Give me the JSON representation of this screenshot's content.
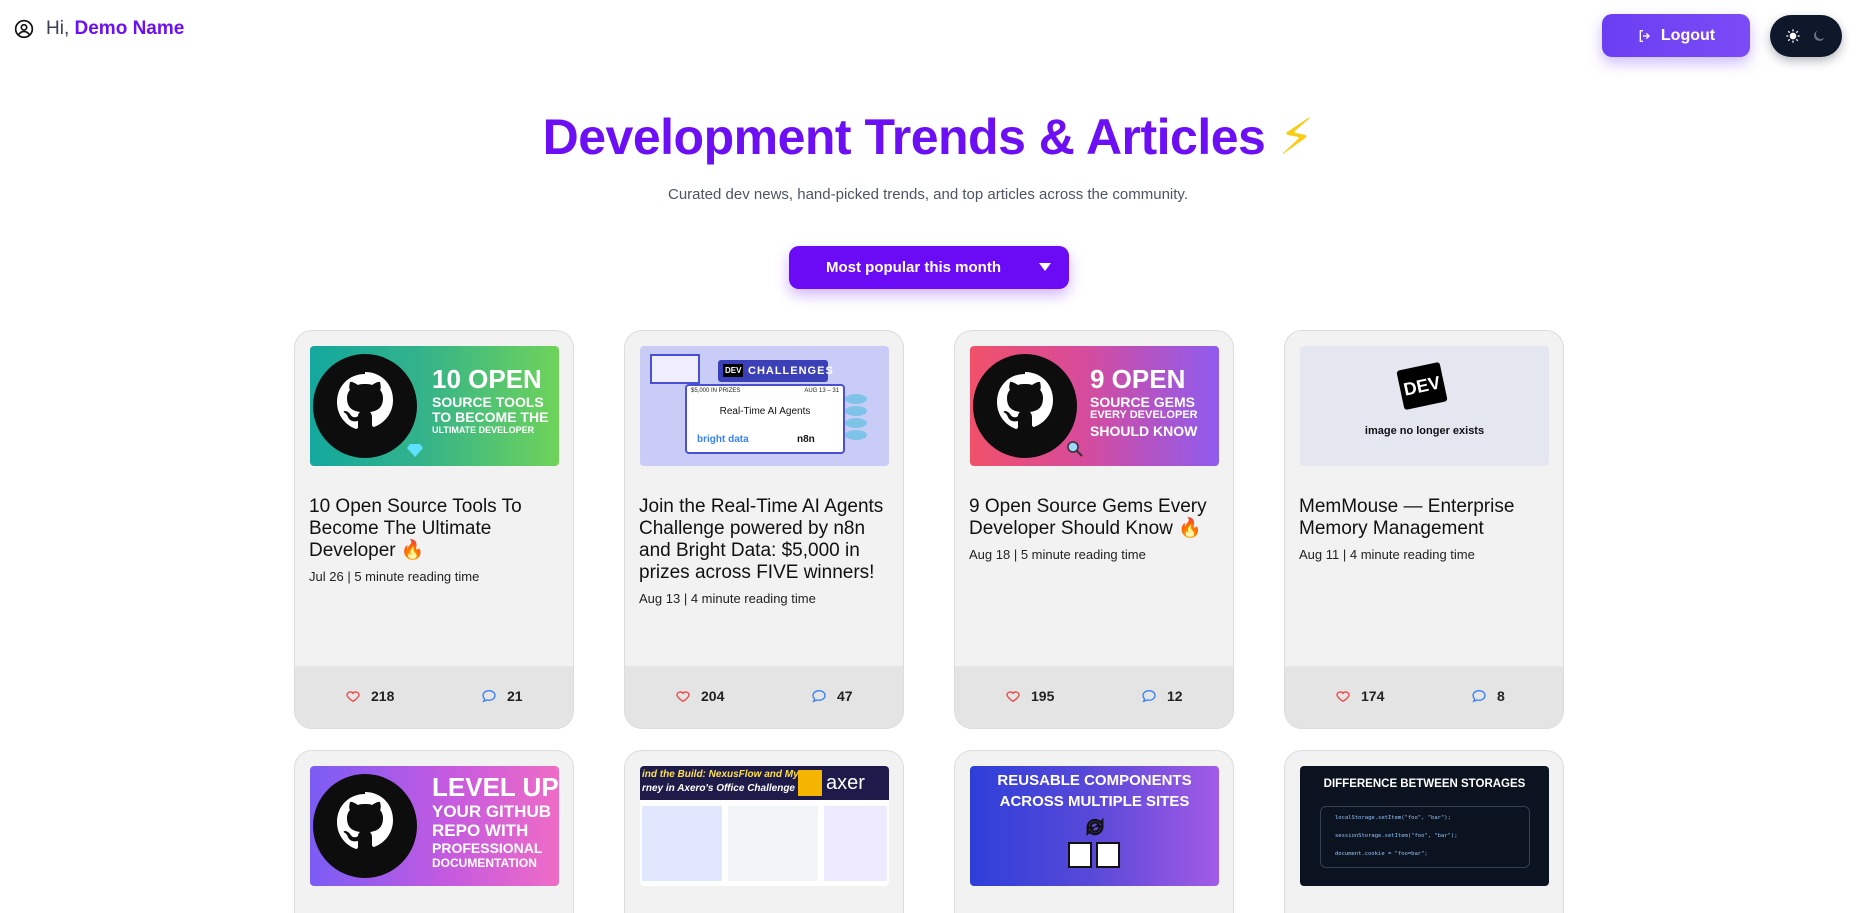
{
  "user": {
    "greeting": "Hi,",
    "name": "Demo Name"
  },
  "header": {
    "logout_label": "Logout"
  },
  "hero": {
    "title": "Development Trends & Articles",
    "emoji": "⚡",
    "subtitle": "Curated dev news, hand-picked trends, and top articles across the community."
  },
  "filter": {
    "selected": "Most popular this month"
  },
  "colors": {
    "accent": "#6d0ff5",
    "button": "#6b0af5",
    "logout": "#6a3ef2",
    "heart": "#ef4444",
    "comment": "#3b82f6"
  },
  "cards": [
    {
      "title": "10 Open Source Tools To Become The Ultimate Developer 🔥",
      "date": "Jul 26",
      "reading": "5 minute reading time",
      "likes": "218",
      "comments": "21",
      "thumb": {
        "line1": "10 OPEN",
        "line2": "SOURCE TOOLS",
        "line3": "TO BECOME THE",
        "line4": "ULTIMATE DEVELOPER"
      }
    },
    {
      "title": "Join the Real-Time AI Agents Challenge powered by n8n and Bright Data: $5,000 in prizes across FIVE winners!",
      "date": "Aug 13",
      "reading": "4 minute reading time",
      "likes": "204",
      "comments": "47",
      "thumb": {
        "badge": "DEV",
        "tag": "CHALLENGES",
        "prize": "$5,000 IN PRIZES",
        "dates": "AUG 13 – 31",
        "headline": "Real-Time AI Agents",
        "brand1": "bright data",
        "brand2": "n8n"
      }
    },
    {
      "title": "9 Open Source Gems Every Developer Should Know 🔥",
      "date": "Aug 18",
      "reading": "5 minute reading time",
      "likes": "195",
      "comments": "12",
      "thumb": {
        "line1": "9 OPEN",
        "line2": "SOURCE GEMS",
        "line3": "EVERY DEVELOPER",
        "line4": "SHOULD KNOW"
      }
    },
    {
      "title": "MemMouse — Enterprise Memory Management",
      "date": "Aug 11",
      "reading": "4 minute reading time",
      "likes": "174",
      "comments": "8",
      "thumb": {
        "logo": "DEV",
        "caption": "image no longer exists"
      }
    },
    {
      "thumb": {
        "line1": "LEVEL UP",
        "line2": "YOUR GITHUB",
        "line3": "REPO WITH",
        "line4": "PROFESSIONAL",
        "line5": "DOCUMENTATION"
      }
    },
    {
      "thumb": {
        "headline_a": "ind the Build: NexusFlow and My",
        "headline_b": "rney in Axero's Office Challenge",
        "brand": "axer"
      }
    },
    {
      "thumb": {
        "line1": "REUSABLE COMPONENTS",
        "line2": "ACROSS MULTIPLE SITES"
      }
    },
    {
      "thumb": {
        "line1": "DIFFERENCE BETWEEN STORAGES",
        "code1": "localStorage.setItem(\"foo\", \"bar\");",
        "code2": "sessionStorage.setItem(\"foo\", \"bar\");",
        "code3": "document.cookie = \"foo=bar\";"
      }
    }
  ]
}
